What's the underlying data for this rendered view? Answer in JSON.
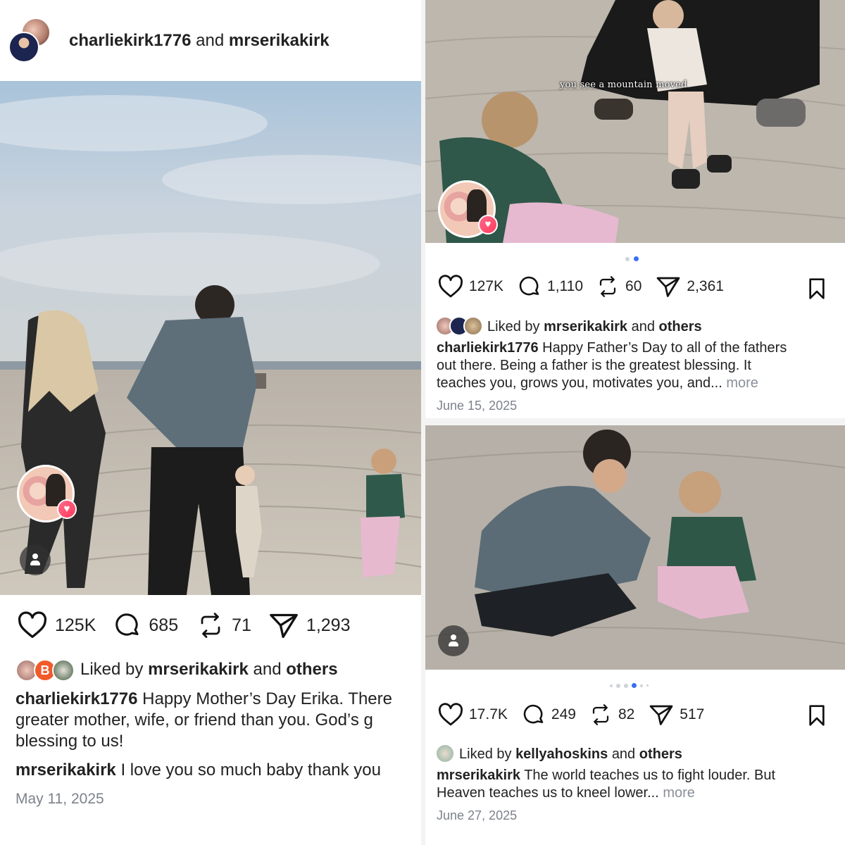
{
  "left_post": {
    "header": {
      "user1": "charliekirk1776",
      "joiner": "and",
      "user2": "mrserikakirk"
    },
    "actions": {
      "likes": "125K",
      "comments": "685",
      "reposts": "71",
      "shares": "1,293"
    },
    "liked_by": {
      "prefix": "Liked by",
      "user": "mrserikakirk",
      "joiner": "and",
      "others": "others"
    },
    "caption": {
      "user": "charliekirk1776",
      "line1": "Happy Mother’s Day Erika. There",
      "line2": "greater mother, wife, or friend than you. God’s g",
      "line3": "blessing to us!"
    },
    "comment": {
      "user": "mrserikakirk",
      "text": "I love you so much baby thank you"
    },
    "date": "May 11, 2025"
  },
  "right_top_post": {
    "dots": {
      "count": 2,
      "active": 1
    },
    "actions": {
      "likes": "127K",
      "comments": "1,110",
      "reposts": "60",
      "shares": "2,361"
    },
    "liked_by": {
      "prefix": "Liked by",
      "user": "mrserikakirk",
      "joiner": "and",
      "others": "others"
    },
    "caption": {
      "user": "charliekirk1776",
      "line1": "Happy Father’s Day to all of the fathers",
      "line2": "out there. Being a father is the greatest blessing. It",
      "line3": "teaches you, grows you, motivates you, and...",
      "more": "more"
    },
    "date": "June 15, 2025"
  },
  "right_bottom_post": {
    "video_caption": "you see a mountain moved",
    "dots": {
      "count": 6,
      "active": 3
    },
    "actions": {
      "likes": "17.7K",
      "comments": "249",
      "reposts": "82",
      "shares": "517"
    },
    "liked_by": {
      "prefix": "Liked by",
      "user": "kellyahoskins",
      "joiner": "and",
      "others": "others"
    },
    "caption": {
      "user": "mrserikakirk",
      "line1": "The world teaches us to fight louder. But",
      "line2": "Heaven teaches us to kneel lower...",
      "more": "more"
    },
    "date": "June 27, 2025"
  },
  "icons": {
    "like": "heart-icon",
    "comment": "comment-bubble-icon",
    "repost": "repost-icon",
    "share": "send-icon",
    "save": "bookmark-icon",
    "user": "user-icon"
  },
  "colors": {
    "active_dot": "#3b6ef5",
    "muted": "#7d828b",
    "heart_badge": "#ff3b5c"
  }
}
